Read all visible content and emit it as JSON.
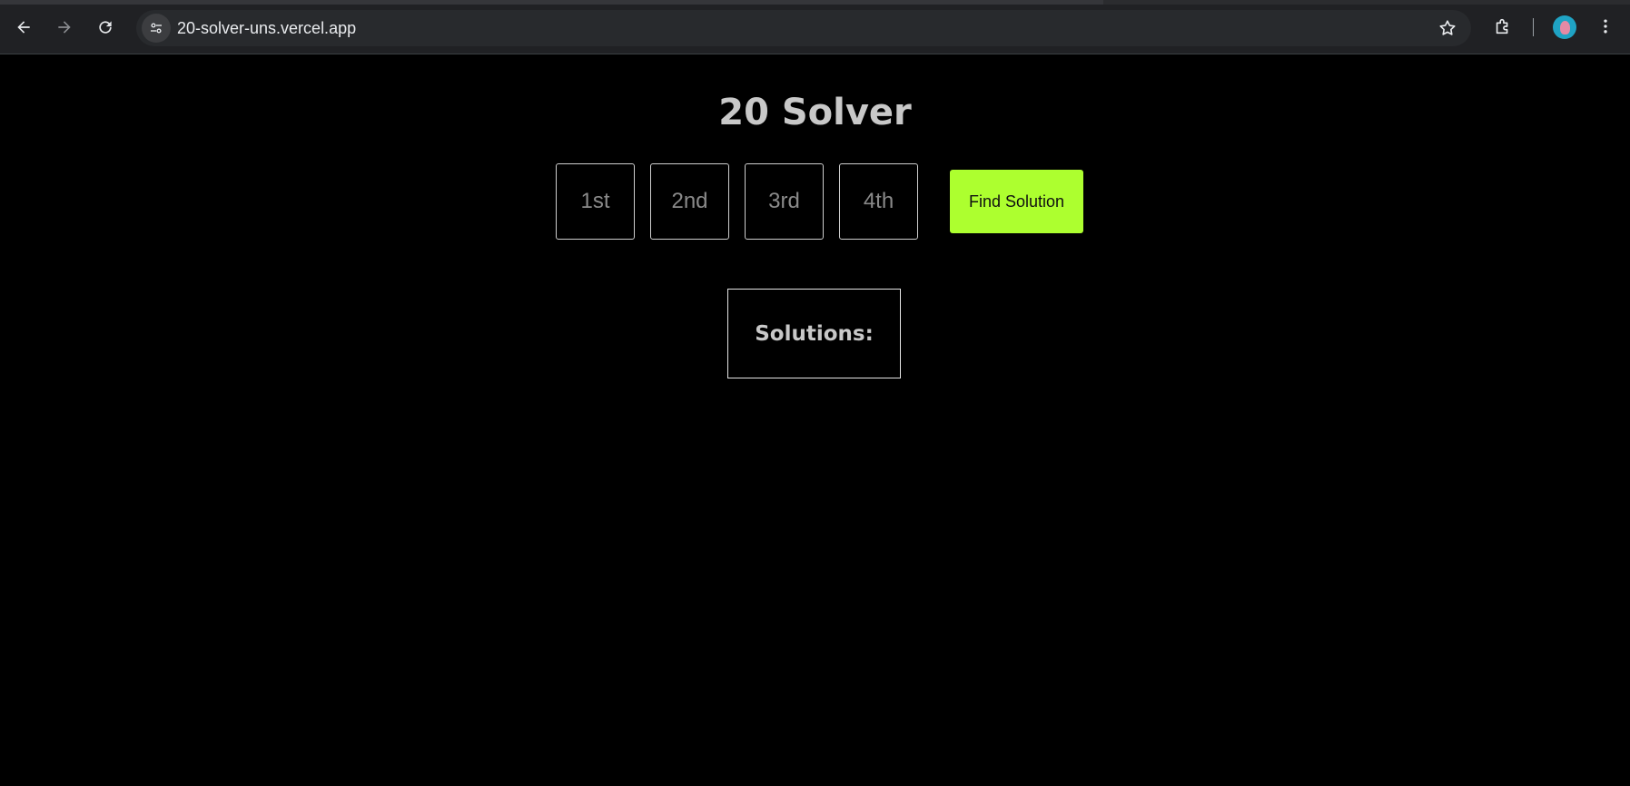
{
  "browser": {
    "url": "20-solver-uns.vercel.app",
    "icons": {
      "back": "back-arrow-icon",
      "forward": "forward-arrow-icon",
      "reload": "reload-icon",
      "site_info": "tune-icon",
      "bookmark": "star-icon",
      "extensions": "puzzle-piece-icon",
      "profile": "avatar",
      "menu": "kebab-menu-icon"
    }
  },
  "app": {
    "title": "20 Solver",
    "inputs": [
      {
        "placeholder": "1st",
        "value": ""
      },
      {
        "placeholder": "2nd",
        "value": ""
      },
      {
        "placeholder": "3rd",
        "value": ""
      },
      {
        "placeholder": "4th",
        "value": ""
      }
    ],
    "find_button_label": "Find Solution",
    "solutions_label": "Solutions:"
  },
  "colors": {
    "background": "#000000",
    "accent": "#adff2f",
    "text": "#c8c8c8",
    "placeholder": "#8a8a8a",
    "border": "#cfcfcf"
  }
}
